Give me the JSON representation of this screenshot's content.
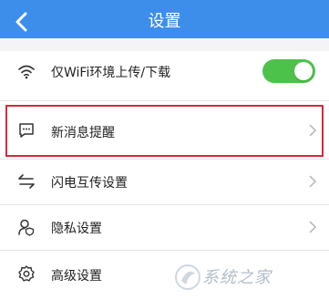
{
  "header": {
    "title": "设置",
    "background": "#3d8eea"
  },
  "settings": {
    "items": [
      {
        "icon": "wifi-icon",
        "label": "仅WiFi环境上传/下载",
        "control": "toggle",
        "toggle_on": true
      },
      {
        "icon": "message-icon",
        "label": "新消息提醒",
        "control": "chevron",
        "highlighted": true
      },
      {
        "icon": "transfer-icon",
        "label": "闪电互传设置",
        "control": "chevron"
      },
      {
        "icon": "privacy-icon",
        "label": "隐私设置",
        "control": "chevron"
      },
      {
        "icon": "gear-icon",
        "label": "高级设置",
        "control": "none"
      }
    ]
  },
  "watermark": {
    "text": "系统之家"
  },
  "colors": {
    "accent": "#3d8eea",
    "toggle_on": "#4cc24a",
    "highlight_border": "#d22c3a"
  }
}
